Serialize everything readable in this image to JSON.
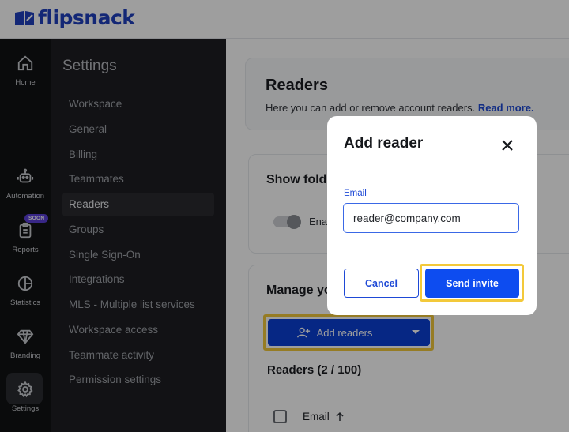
{
  "brand": {
    "name": "flipsnack",
    "color": "#1f3fbf"
  },
  "rail": {
    "items": [
      {
        "label": "Home",
        "icon": "home-icon"
      },
      {
        "label": "Automation",
        "icon": "robot-icon"
      },
      {
        "label": "Reports",
        "icon": "clipboard-icon",
        "badge": "SOON"
      },
      {
        "label": "Statistics",
        "icon": "pie-chart-icon"
      },
      {
        "label": "Branding",
        "icon": "diamond-icon"
      },
      {
        "label": "Settings",
        "icon": "gear-icon",
        "active": true
      }
    ]
  },
  "settings": {
    "title": "Settings",
    "items": [
      "Workspace",
      "General",
      "Billing",
      "Teammates",
      "Readers",
      "Groups",
      "Single Sign-On",
      "Integrations",
      "MLS - Multiple list services",
      "Workspace access",
      "Teammate activity",
      "Permission settings"
    ],
    "active": "Readers"
  },
  "main": {
    "title": "Readers",
    "description": "Here you can add or remove account readers.",
    "read_more": "Read more.",
    "show_folders_title": "Show fold",
    "toggle_label": "Ena",
    "manage_title": "Manage yo",
    "add_readers_label": "Add readers",
    "readers_count": "Readers (2 / 100)",
    "email_column": "Email"
  },
  "modal": {
    "title": "Add reader",
    "email_label": "Email",
    "email_value": "reader@company.com",
    "cancel_label": "Cancel",
    "send_label": "Send invite"
  },
  "colors": {
    "accent": "#0d4cf0",
    "highlight": "#f3c93a",
    "sidebar_dark": "#1d1e22",
    "rail_dark": "#111214"
  }
}
